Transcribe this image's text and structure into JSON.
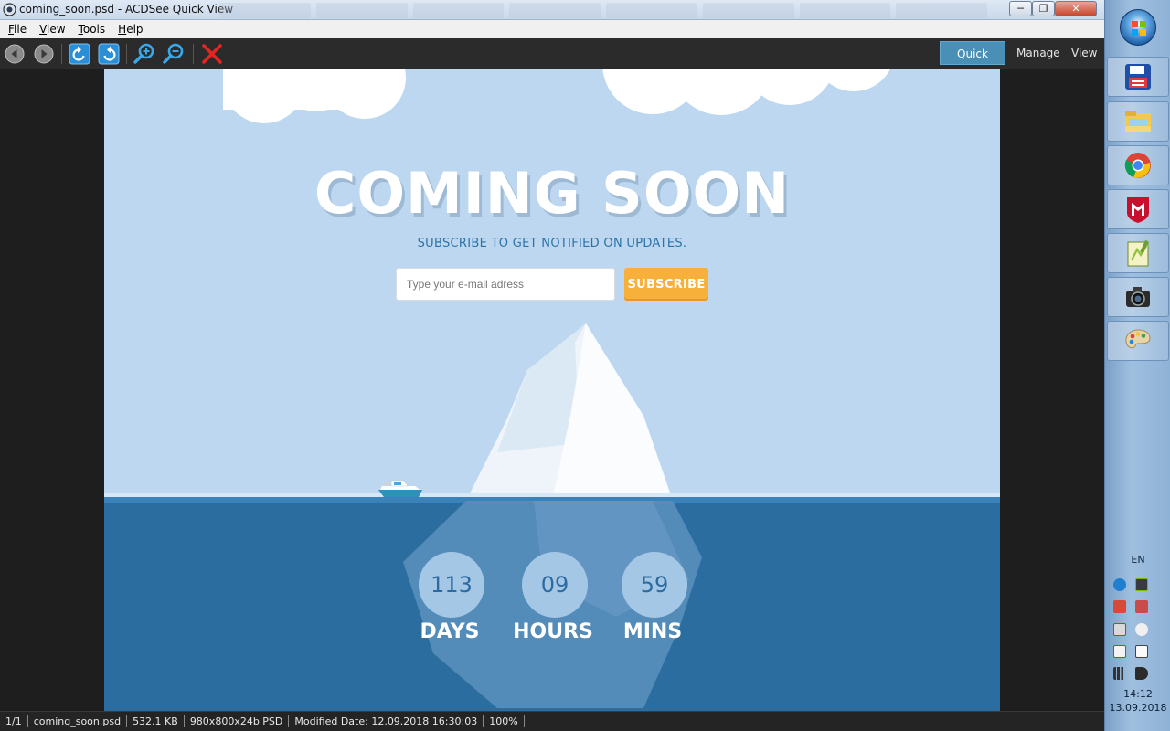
{
  "window": {
    "title": "coming_soon.psd - ACDSee Quick View",
    "minimize_glyph": "─",
    "maximize_glyph": "❐",
    "close_glyph": "✕"
  },
  "menu": {
    "items": [
      {
        "first": "F",
        "rest": "ile"
      },
      {
        "first": "V",
        "rest": "iew"
      },
      {
        "first": "T",
        "rest": "ools"
      },
      {
        "first": "H",
        "rest": "elp"
      }
    ]
  },
  "toolbar": {
    "icons": [
      "back-arrow-icon",
      "forward-arrow-icon",
      "rotate-left-icon",
      "rotate-right-icon",
      "zoom-in-icon",
      "zoom-out-icon",
      "close-x-icon"
    ],
    "modes": {
      "quick_view": "Quick View",
      "manage": "Manage",
      "view": "View"
    },
    "accent": "#4a8fb6"
  },
  "image": {
    "headline": "COMING SOON",
    "subheadline": "SUBSCRIBE TO GET NOTIFIED ON UPDATES.",
    "email_placeholder": "Type your e-mail adress",
    "email_value": "",
    "subscribe_label": "SUBSCRIBE",
    "countdown": {
      "days": {
        "value": "113",
        "label": "DAYS"
      },
      "hours": {
        "value": "09",
        "label": "HOURS"
      },
      "mins": {
        "value": "59",
        "label": "MINS"
      }
    },
    "colors": {
      "sky": "#bcd7ef",
      "sea": "#2a6d9e",
      "button": "#f7b13a",
      "headline_shadow": "#9db9d3"
    }
  },
  "status": {
    "index": "1/1",
    "filename": "coming_soon.psd",
    "filesize": "532.1 KB",
    "dimensions": "980x800x24b PSD",
    "modified": "Modified Date: 12.09.2018 16:30:03",
    "zoom": "100%"
  },
  "taskbar": {
    "apps": [
      "save-disk-icon",
      "file-explorer-icon",
      "chrome-icon",
      "mcafee-icon",
      "notepad-plus-plus-icon",
      "camera-icon",
      "paint-palette-icon"
    ],
    "language": "EN",
    "time": "14:12",
    "date": "13.09.2018"
  }
}
